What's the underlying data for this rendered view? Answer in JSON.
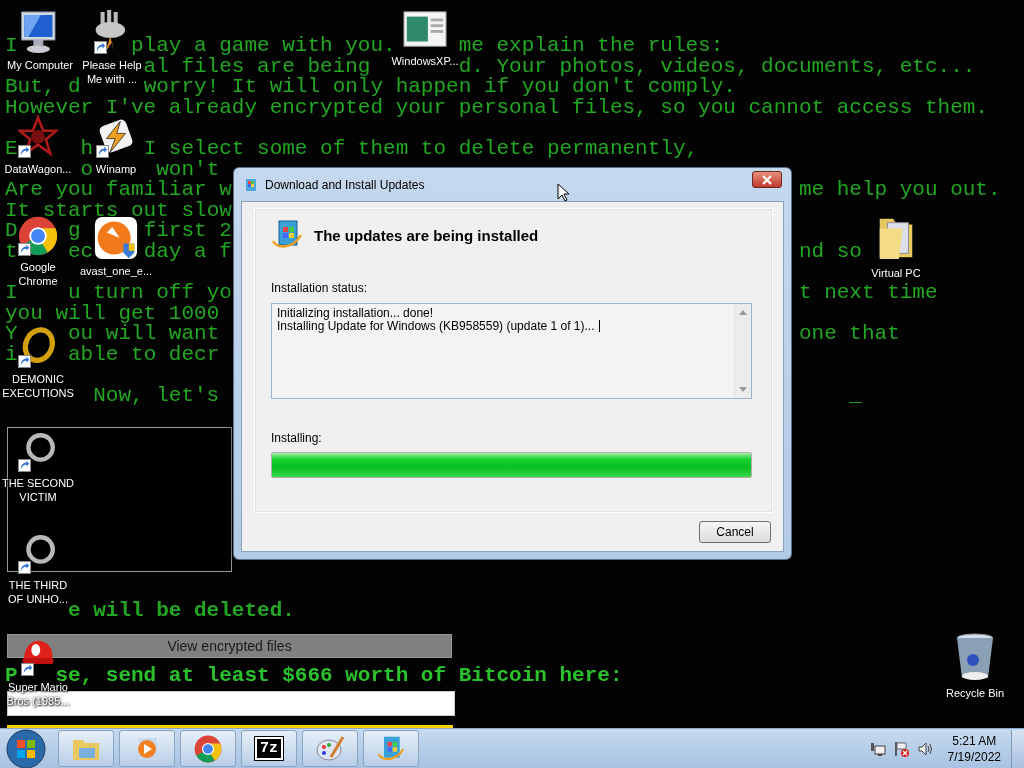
{
  "ransom_window": {
    "paragraphs": [
      [
        [
          "I",
          "play a game with you.",
          "me explain the rules:"
        ],
        [
          "al files are being",
          "d. Your photos, videos, documents, etc..."
        ],
        [
          "But, d",
          "worry! It will only happen if you don't comply."
        ],
        [
          "However I've already encrypted your personal files, so you cannot access them."
        ]
      ],
      [
        [
          "E",
          "h",
          "I select some of them to delete permanently,"
        ],
        [
          "o",
          "won't"
        ],
        [
          "Are you familiar w",
          "me help you out."
        ],
        [
          "It starts out slow"
        ],
        [
          "D",
          "g",
          "first 2"
        ],
        [
          "t",
          "ec",
          "day a f",
          "nd so"
        ]
      ],
      [
        [
          "I",
          "u turn off yo",
          "t next time"
        ],
        [
          "you will get 1000"
        ],
        [
          "Y",
          "ou will want",
          "one that"
        ],
        [
          "i",
          "able to decr"
        ]
      ],
      [
        [
          "Now, let's",
          "_"
        ]
      ]
    ],
    "deleted_line": [
      "e will be deleted."
    ],
    "view_button": "View encrypted files",
    "bitcoin_line": [
      "P",
      "se, send at least $666 worth of Bitcoin here:"
    ]
  },
  "desktop_icons": [
    {
      "kind": "computer",
      "label": [
        "My Computer"
      ],
      "shortcut": false
    },
    {
      "kind": "cloud",
      "label": [
        "Please Help",
        "Me with ..."
      ],
      "shortcut": true
    },
    {
      "kind": "window",
      "label": [
        "WindowsXP..."
      ],
      "shortcut": false
    },
    {
      "kind": "star",
      "label": [
        "DataWagon..."
      ],
      "shortcut": true
    },
    {
      "kind": "bolt",
      "label": [
        "Winamp"
      ],
      "shortcut": true
    },
    {
      "kind": "chrome",
      "label": [
        "Google",
        "Chrome"
      ],
      "shortcut": true
    },
    {
      "kind": "avast",
      "label": [
        "avast_one_e..."
      ],
      "shortcut": false
    },
    {
      "kind": "gold-ring",
      "label": [
        "DEMONIC",
        "EXECUTIONS"
      ],
      "shortcut": true
    },
    {
      "kind": "silver-ring",
      "label": [
        "THE SECOND",
        "VICTIM"
      ],
      "shortcut": true
    },
    {
      "kind": "silver-ring",
      "label": [
        "THE THIRD",
        "OF UNHO..."
      ],
      "shortcut": true
    },
    {
      "kind": "cap",
      "label": [
        "Super Mario",
        "Bros (1985..."
      ],
      "shortcut": true
    },
    {
      "kind": "folder",
      "label": [
        "Virtual PC"
      ],
      "shortcut": false
    },
    {
      "kind": "bin",
      "label": [
        "Recycle Bin"
      ],
      "shortcut": false
    }
  ],
  "dialog": {
    "title": "Download and Install Updates",
    "heading": "The updates are being installed",
    "status_label": "Installation status:",
    "log": [
      "Initializing installation... done!",
      "Installing Update for Windows (KB958559) (update 1 of 1)..."
    ],
    "progress_label": "Installing:",
    "progress": {
      "level": 1
    },
    "cancel_button": "Cancel"
  },
  "taskbar": {
    "items": [
      {
        "kind": "explorer"
      },
      {
        "kind": "media"
      },
      {
        "kind": "chrome"
      },
      {
        "kind": "archive",
        "label": "7z"
      },
      {
        "kind": "paint"
      },
      {
        "kind": "update"
      }
    ],
    "clock": {
      "time": "5:21 AM",
      "date": "7/19/2022"
    }
  }
}
